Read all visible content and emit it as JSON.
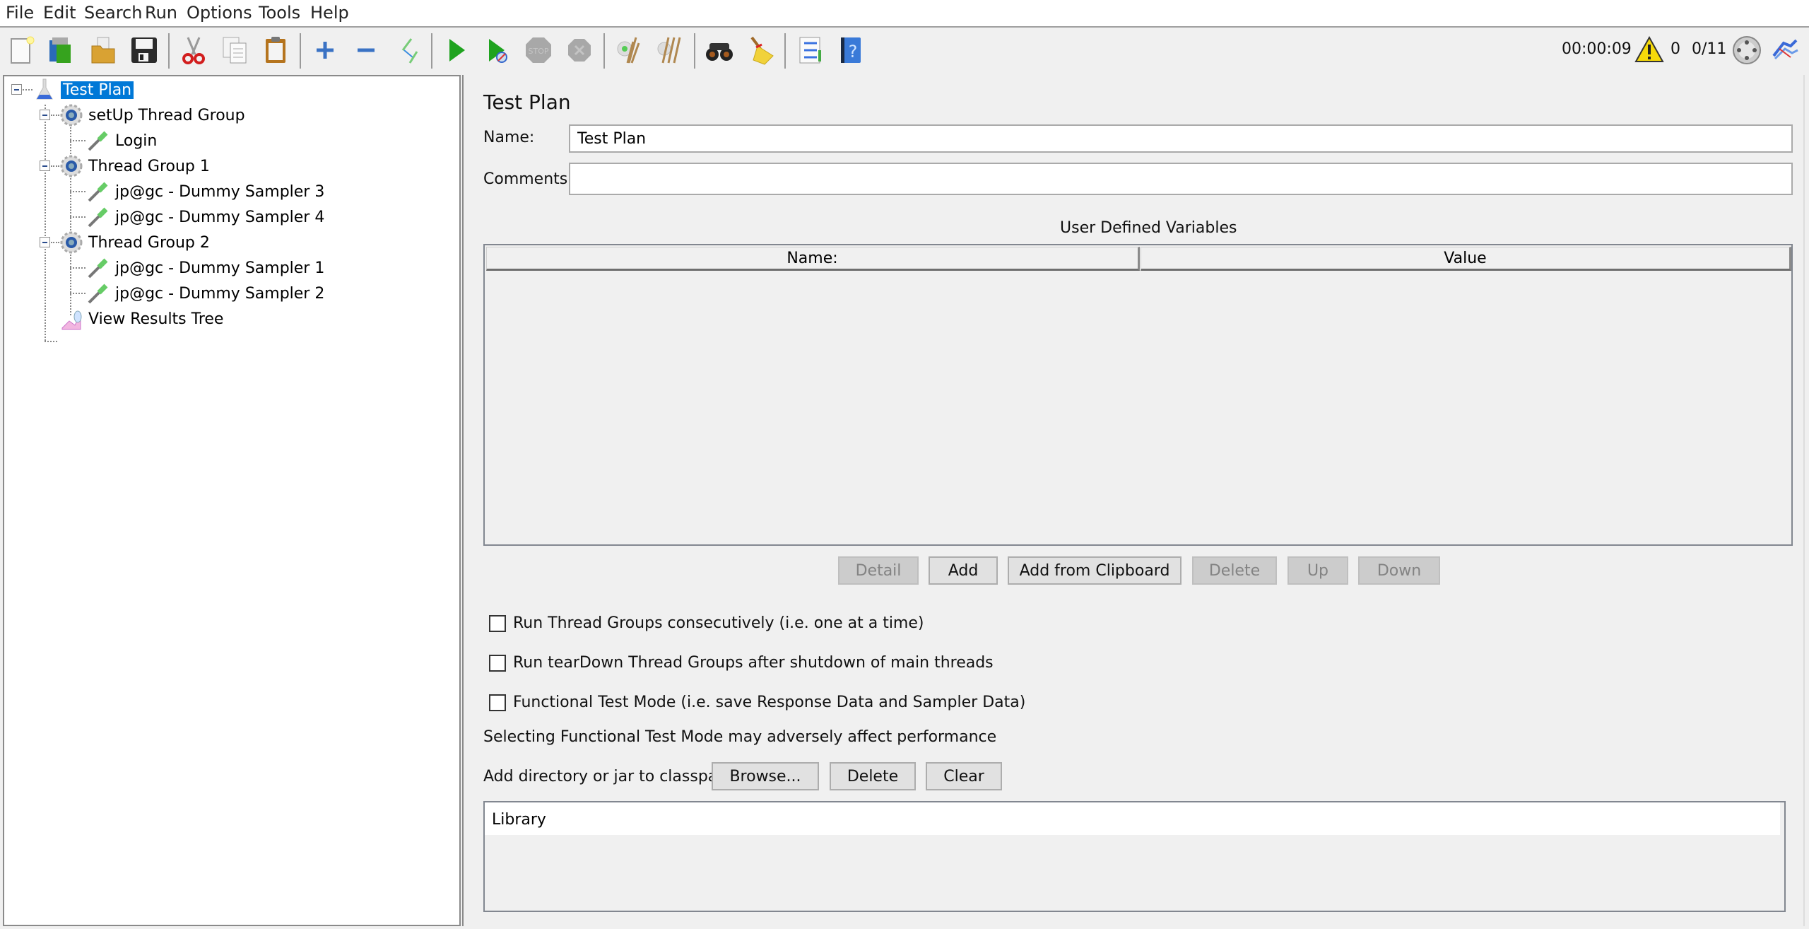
{
  "menu": [
    "File",
    "Edit",
    "Search",
    "Run",
    "Options",
    "Tools",
    "Help"
  ],
  "toolbar": {
    "buttons": [
      {
        "name": "new-icon",
        "enabled": true
      },
      {
        "name": "templates-icon",
        "enabled": true
      },
      {
        "name": "open-icon",
        "enabled": true
      },
      {
        "name": "save-icon",
        "enabled": true
      },
      {
        "name": "cut-icon",
        "enabled": true
      },
      {
        "name": "copy-icon",
        "enabled": true
      },
      {
        "name": "paste-icon",
        "enabled": true
      },
      {
        "name": "expand-all-icon",
        "enabled": true
      },
      {
        "name": "collapse-all-icon",
        "enabled": true
      },
      {
        "name": "toggle-icon",
        "enabled": true
      },
      {
        "name": "start-icon",
        "enabled": true
      },
      {
        "name": "start-no-pauses-icon",
        "enabled": true
      },
      {
        "name": "stop-icon",
        "enabled": false
      },
      {
        "name": "shutdown-icon",
        "enabled": false
      },
      {
        "name": "clear-icon",
        "enabled": true
      },
      {
        "name": "clear-all-icon",
        "enabled": true
      },
      {
        "name": "search-icon",
        "enabled": true
      },
      {
        "name": "reset-search-icon",
        "enabled": true
      },
      {
        "name": "function-helper-icon",
        "enabled": true
      },
      {
        "name": "help-icon",
        "enabled": true
      }
    ],
    "status": {
      "elapsed_time": "00:00:09",
      "warning_count": "0",
      "threads": "0/11"
    }
  },
  "tree": {
    "items": [
      {
        "label": "Test Plan",
        "type": "test-plan",
        "level": 0,
        "selected": true
      },
      {
        "label": "setUp Thread Group",
        "type": "thread-group",
        "level": 1
      },
      {
        "label": "Login",
        "type": "sampler",
        "level": 2
      },
      {
        "label": "Thread Group 1",
        "type": "thread-group",
        "level": 1
      },
      {
        "label": "jp@gc - Dummy Sampler 3",
        "type": "sampler",
        "level": 2
      },
      {
        "label": "jp@gc - Dummy Sampler 4",
        "type": "sampler",
        "level": 2
      },
      {
        "label": "Thread Group 2",
        "type": "thread-group",
        "level": 1
      },
      {
        "label": "jp@gc - Dummy Sampler 1",
        "type": "sampler",
        "level": 2
      },
      {
        "label": "jp@gc - Dummy Sampler 2",
        "type": "sampler",
        "level": 2
      },
      {
        "label": "View Results Tree",
        "type": "listener",
        "level": 1
      }
    ]
  },
  "panel": {
    "title": "Test Plan",
    "name_label": "Name:",
    "name_value": "Test Plan",
    "comments_label": "Comments:",
    "comments_value": "",
    "udv_title": "User Defined Variables",
    "udv_columns": [
      "Name:",
      "Value"
    ],
    "udv_rows": [],
    "udv_buttons": [
      {
        "label": "Detail",
        "enabled": false
      },
      {
        "label": "Add",
        "enabled": true
      },
      {
        "label": "Add from Clipboard",
        "enabled": true
      },
      {
        "label": "Delete",
        "enabled": false
      },
      {
        "label": "Up",
        "enabled": false
      },
      {
        "label": "Down",
        "enabled": false
      }
    ],
    "checkboxes": [
      {
        "label": "Run Thread Groups consecutively (i.e. one at a time)",
        "checked": false
      },
      {
        "label": "Run tearDown Thread Groups after shutdown of main threads",
        "checked": false
      },
      {
        "label": "Functional Test Mode (i.e. save Response Data and Sampler Data)",
        "checked": false
      }
    ],
    "functional_note": "Selecting Functional Test Mode may adversely affect performance",
    "classpath_label": "Add directory or jar to classpath",
    "classpath_buttons": [
      "Browse...",
      "Delete",
      "Clear"
    ],
    "library_header": "Library",
    "library_rows": []
  }
}
